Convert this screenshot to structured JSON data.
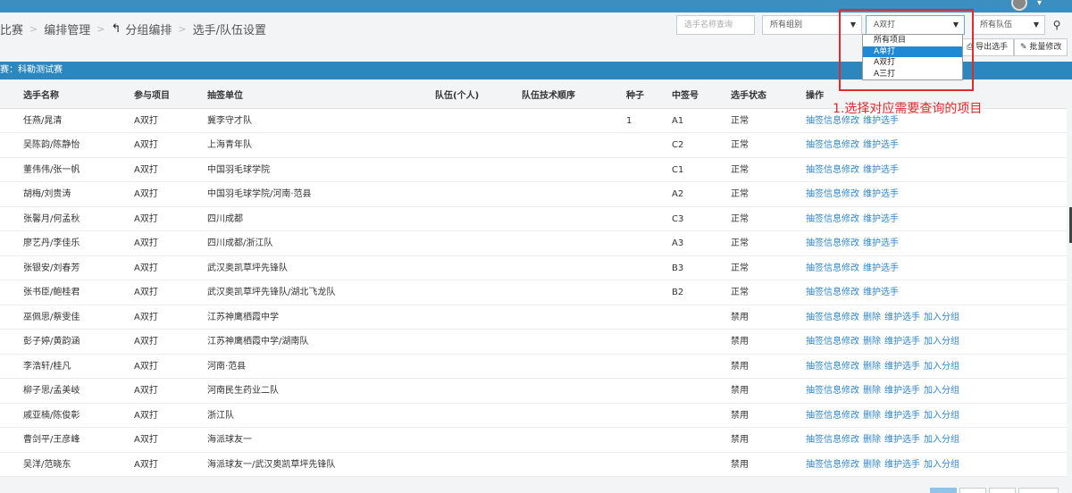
{
  "breadcrumb": {
    "root": "比赛",
    "level1": "编排管理",
    "level2": "分组编排",
    "level3": "选手/队伍设置"
  },
  "filters": {
    "search_placeholder": "选手名称查询",
    "group": "所有组别",
    "event": "A双打",
    "team": "所有队伍"
  },
  "buttons": {
    "export": "导出选手",
    "batch_edit": "批量修改"
  },
  "dropdown": {
    "options": [
      "所有项目",
      "A单打",
      "A双打",
      "A三打"
    ],
    "selected_index": 1
  },
  "annotation": "1.选择对应需要查询的项目",
  "section_title": "赛：科勒测试赛",
  "columns": {
    "name": "选手名称",
    "event": "参与项目",
    "unit": "抽签单位",
    "team": "队伍(个人)",
    "order": "队伍技术顺序",
    "seed": "种子",
    "draw": "中签号",
    "status": "选手状态",
    "ops": "操作"
  },
  "ops_labels": {
    "edit": "抽签信息修改",
    "delete": "删除",
    "maintain": "维护选手",
    "add_group": "加入分组"
  },
  "rows": [
    {
      "name": "任燕/晁清",
      "event": "A双打",
      "unit": "冀李守才队",
      "seed": "1",
      "draw": "A1",
      "status": "正常",
      "banned": false
    },
    {
      "name": "吴陈韵/陈静怡",
      "event": "A双打",
      "unit": "上海青年队",
      "seed": "",
      "draw": "C2",
      "status": "正常",
      "banned": false
    },
    {
      "name": "董伟伟/张一帆",
      "event": "A双打",
      "unit": "中国羽毛球学院",
      "seed": "",
      "draw": "C1",
      "status": "正常",
      "banned": false
    },
    {
      "name": "胡梅/刘贵涛",
      "event": "A双打",
      "unit": "中国羽毛球学院/河南·范县",
      "seed": "",
      "draw": "A2",
      "status": "正常",
      "banned": false
    },
    {
      "name": "张馨月/何孟秋",
      "event": "A双打",
      "unit": "四川成都",
      "seed": "",
      "draw": "C3",
      "status": "正常",
      "banned": false
    },
    {
      "name": "廖艺丹/李佳乐",
      "event": "A双打",
      "unit": "四川成都/浙江队",
      "seed": "",
      "draw": "A3",
      "status": "正常",
      "banned": false
    },
    {
      "name": "张银安/刘春芳",
      "event": "A双打",
      "unit": "武汉奥凯草坪先锋队",
      "seed": "",
      "draw": "B3",
      "status": "正常",
      "banned": false
    },
    {
      "name": "张书臣/鲍桂君",
      "event": "A双打",
      "unit": "武汉奥凯草坪先锋队/湖北飞龙队",
      "seed": "",
      "draw": "B2",
      "status": "正常",
      "banned": false
    },
    {
      "name": "巫佩思/蔡雯佳",
      "event": "A双打",
      "unit": "江苏神鹰栖霞中学",
      "seed": "",
      "draw": "",
      "status": "禁用",
      "banned": true
    },
    {
      "name": "彭子婷/黄韵涵",
      "event": "A双打",
      "unit": "江苏神鹰栖霞中学/湖南队",
      "seed": "",
      "draw": "",
      "status": "禁用",
      "banned": true
    },
    {
      "name": "李浩轩/桂凡",
      "event": "A双打",
      "unit": "河南·范县",
      "seed": "",
      "draw": "",
      "status": "禁用",
      "banned": true
    },
    {
      "name": "柳子思/孟美岐",
      "event": "A双打",
      "unit": "河南民生药业二队",
      "seed": "",
      "draw": "",
      "status": "禁用",
      "banned": true
    },
    {
      "name": "戚亚楠/陈俊彰",
      "event": "A双打",
      "unit": "浙江队",
      "seed": "",
      "draw": "",
      "status": "禁用",
      "banned": true
    },
    {
      "name": "曹剑平/王彦峰",
      "event": "A双打",
      "unit": "海派球友一",
      "seed": "",
      "draw": "",
      "status": "禁用",
      "banned": true
    },
    {
      "name": "吴洋/范晓东",
      "event": "A双打",
      "unit": "海派球友一/武汉奥凯草坪先锋队",
      "seed": "",
      "draw": "",
      "status": "禁用",
      "banned": true
    }
  ],
  "colors": {
    "topbar": "#3a8fc0",
    "section": "#2d87bf",
    "link": "#2f86c9",
    "annotation": "#e02b2b"
  }
}
